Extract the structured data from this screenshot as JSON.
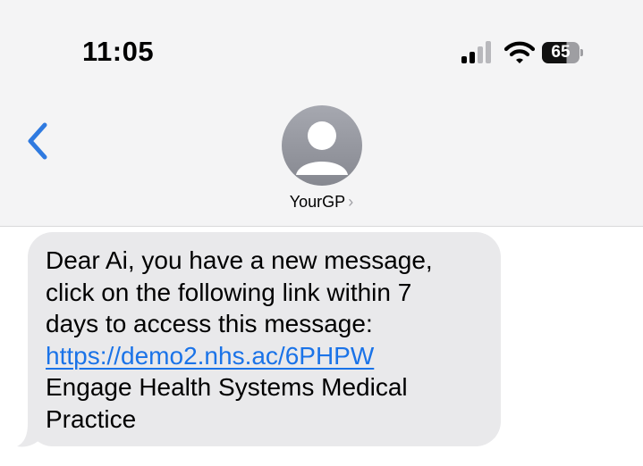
{
  "status_bar": {
    "time": "11:05",
    "battery_level": "65",
    "icons": [
      "signal-icon",
      "wifi-icon",
      "battery-icon"
    ]
  },
  "nav": {
    "back_icon": "chevron-left-icon",
    "contact_name": "YourGP",
    "contact_chevron": "›",
    "avatar_icon": "person-silhouette-icon"
  },
  "message": {
    "lines": [
      "Dear Ai, you have a new message,",
      "click on the following link within 7",
      "days to access this message:"
    ],
    "link": "https://demo2.nhs.ac/6PHPW",
    "closing_lines": [
      "Engage Health Systems Medical",
      "Practice"
    ]
  },
  "colors": {
    "accent_blue": "#1a73e8",
    "back_chevron": "#2f7ae0",
    "bubble_bg": "#e9e9eb",
    "header_bg": "#f4f4f5"
  }
}
